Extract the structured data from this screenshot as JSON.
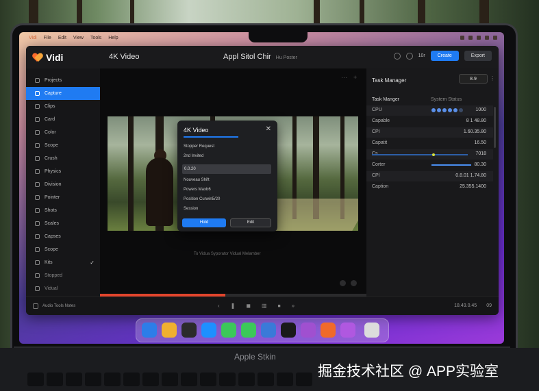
{
  "menubar": {
    "items": [
      "Vidi",
      "File",
      "Edit",
      "View",
      "Tools",
      "Help"
    ]
  },
  "app": {
    "name": "Vidi",
    "project_title": "4K Video",
    "document_title": "Appl Sitol Chir",
    "document_subtitle": "Hu Poster"
  },
  "toolbar": {
    "label": "10r",
    "primary_button": "Create",
    "secondary_button": "Export"
  },
  "sidebar": {
    "items": [
      {
        "label": "Projects",
        "state": "normal"
      },
      {
        "label": "Capture",
        "state": "active"
      },
      {
        "label": "Clips",
        "state": "normal"
      },
      {
        "label": "Card",
        "state": "normal"
      },
      {
        "label": "Color",
        "state": "normal"
      },
      {
        "label": "Scope",
        "state": "normal"
      },
      {
        "label": "Crush",
        "state": "normal"
      },
      {
        "label": "Physics",
        "state": "normal"
      },
      {
        "label": "Division",
        "state": "normal"
      },
      {
        "label": "Pointer",
        "state": "normal"
      },
      {
        "label": "Shots",
        "state": "normal"
      },
      {
        "label": "Scales",
        "state": "normal"
      },
      {
        "label": "Capses",
        "state": "normal"
      },
      {
        "label": "Scope",
        "state": "normal"
      },
      {
        "label": "Kits",
        "state": "checked"
      },
      {
        "label": "Stopped",
        "state": "dim"
      },
      {
        "label": "Vidual",
        "state": "dim"
      }
    ]
  },
  "dialog": {
    "title": "4K Video",
    "lines": [
      "Stopper Request",
      "2nd Invited"
    ],
    "field_value": "0.0.20",
    "lines_after": [
      "Nouveau Shift",
      "Powers Maxb6",
      "Position Curwin5/20",
      "Session"
    ],
    "ok_label": "Hold",
    "cancel_label": "Edit"
  },
  "preview": {
    "caption": "To Vidua Syporator Vidual Melamber"
  },
  "playback": {
    "progress_percent": 47
  },
  "panel": {
    "title": "Task Manager",
    "select_value": "8.9",
    "header": "Task Manger",
    "header_sub": "System Status",
    "rows": [
      {
        "label": "CPU",
        "value": "1000"
      },
      {
        "label": "Capable",
        "value": "8 1 48.80"
      },
      {
        "label": "CPI",
        "value": "1.60.35.80"
      },
      {
        "label": "Capatit",
        "value": "16.50"
      },
      {
        "label": "Cs",
        "value": "7018"
      },
      {
        "label": "Corter",
        "value": "80.30"
      },
      {
        "label": "CPl",
        "value": "0.8.01 1.74.80"
      },
      {
        "label": "Caption",
        "value": "25.355.1400"
      }
    ]
  },
  "bottombar": {
    "left_text": "Audio Tools Notes",
    "timecode": "18.49.0.45",
    "zoom": "09"
  },
  "dock": {
    "icons": [
      {
        "name": "finder-icon",
        "color": "#2d7de8"
      },
      {
        "name": "photos-icon",
        "color": "#f0b030"
      },
      {
        "name": "dashboard-icon",
        "color": "#2b2b2b"
      },
      {
        "name": "appstore-icon",
        "color": "#1e90ff"
      },
      {
        "name": "messages-icon",
        "color": "#3cc85a"
      },
      {
        "name": "facetime-icon",
        "color": "#3cc85a"
      },
      {
        "name": "mail-icon",
        "color": "#3a7ad8"
      },
      {
        "name": "logic-icon",
        "color": "#1a1a1a"
      },
      {
        "name": "podcast-icon",
        "color": "#a050d0"
      },
      {
        "name": "garageband-icon",
        "color": "#f06a2a"
      },
      {
        "name": "podcasts-icon",
        "color": "#b058e0"
      },
      {
        "name": "trash-icon",
        "color": "#dcdcdc"
      }
    ]
  },
  "laptop": {
    "brand": "Apple Stkin"
  },
  "watermark": "掘金技术社区 @ APP实验室"
}
